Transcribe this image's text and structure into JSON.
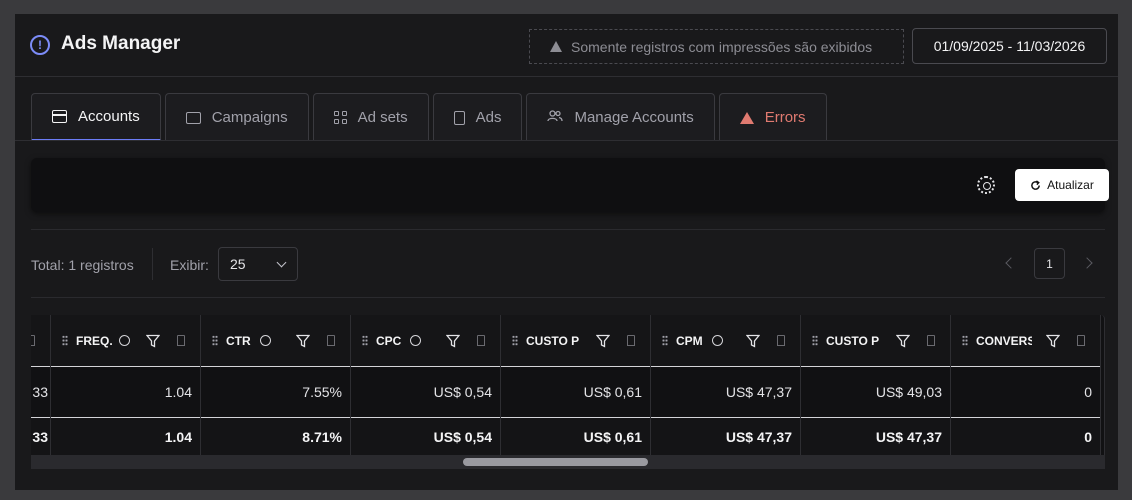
{
  "header": {
    "title": "Ads Manager",
    "notice": "Somente registros com impressões são exibidos",
    "date_range": "01/09/2025 - 11/03/2026"
  },
  "tabs": [
    {
      "label": "Accounts",
      "icon": "credit-card-icon",
      "active": true
    },
    {
      "label": "Campaigns",
      "icon": "folder-icon"
    },
    {
      "label": "Ad sets",
      "icon": "grid-icon"
    },
    {
      "label": "Ads",
      "icon": "document-icon"
    },
    {
      "label": "Manage Accounts",
      "icon": "users-icon"
    },
    {
      "label": "Errors",
      "icon": "warning-icon",
      "color": "#e07a70"
    }
  ],
  "toolbar": {
    "refresh_label": "Atualizar"
  },
  "pagination": {
    "total": "Total: 1 registros",
    "show_label": "Exibir:",
    "page_size": "25",
    "current_page": "1"
  },
  "table": {
    "first_col": {
      "row": "33",
      "total": "33"
    },
    "columns": [
      {
        "header": "FREQ.",
        "row": "1.04",
        "total": "1.04"
      },
      {
        "header": "CTR",
        "row": "7.55%",
        "total": "8.71%"
      },
      {
        "header": "CPC",
        "row": "US$ 0,54",
        "total": "US$ 0,54"
      },
      {
        "header": "CUSTO P",
        "row": "US$ 0,61",
        "total": "US$ 0,61"
      },
      {
        "header": "CPM",
        "row": "US$ 47,37",
        "total": "US$ 47,37"
      },
      {
        "header": "CUSTO P",
        "row": "US$ 49,03",
        "total": "US$ 47,37"
      },
      {
        "header": "CONVERS",
        "row": "0",
        "total": "0"
      }
    ]
  },
  "colors": {
    "accent": "#6b7cf6",
    "error": "#e07a70",
    "background": "#19191b"
  }
}
